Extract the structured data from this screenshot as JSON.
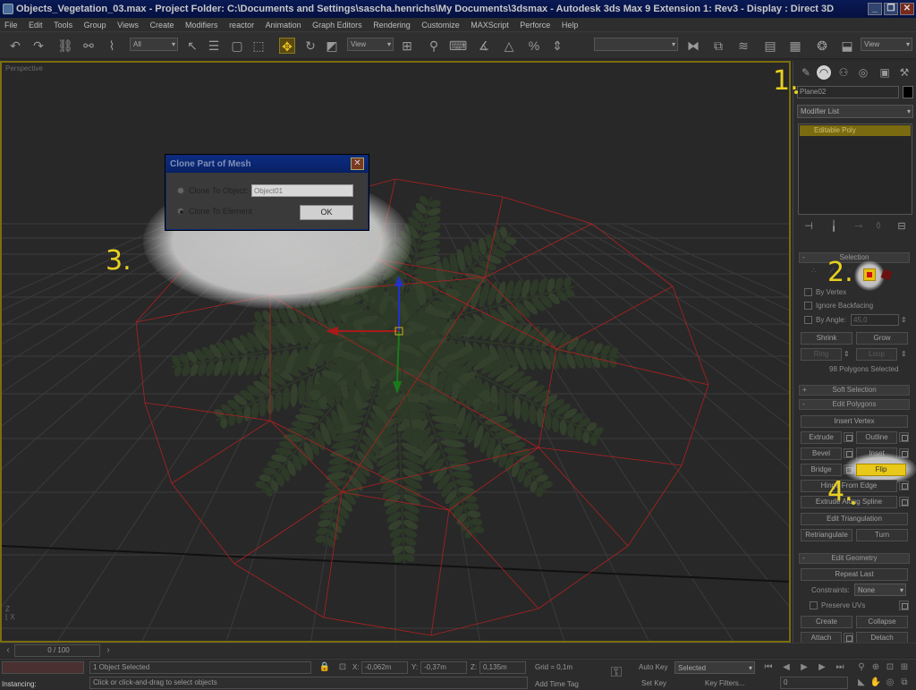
{
  "window": {
    "title": "Objects_Vegetation_03.max    - Project Folder: C:\\Documents and Settings\\sascha.henrichs\\My Documents\\3dsmax    - Autodesk 3ds Max 9 Extension 1: Rev3    - Display : Direct 3D"
  },
  "menu": [
    "File",
    "Edit",
    "Tools",
    "Group",
    "Views",
    "Create",
    "Modifiers",
    "reactor",
    "Animation",
    "Graph Editors",
    "Rendering",
    "Customize",
    "MAXScript",
    "Perforce",
    "Help"
  ],
  "toolbar": {
    "selection_filter": "All",
    "reference_coord": "View",
    "named_selection": "",
    "view_dropdown": "View"
  },
  "viewport": {
    "label": "Perspective"
  },
  "dialog": {
    "title": "Clone Part of Mesh",
    "option_object": "Clone To Object:",
    "object_name_placeholder": "Object01",
    "option_element": "Clone To Element",
    "ok_label": "OK"
  },
  "callouts": {
    "one": "1.",
    "two": "2.",
    "three": "3.",
    "four": "4."
  },
  "command_panel": {
    "object_name": "Plane02",
    "modifier_list": "Modifier List",
    "stack_item": "Editable Poly",
    "selection": {
      "header": "Selection",
      "by_vertex": "By Vertex",
      "ignore_backfacing": "Ignore Backfacing",
      "by_angle": "By Angle:",
      "angle_value": "45,0",
      "shrink": "Shrink",
      "grow": "Grow",
      "ring": "Ring",
      "loop": "Loop",
      "status": "98 Polygons Selected"
    },
    "soft_selection": "Soft Selection",
    "edit_polygons": {
      "header": "Edit Polygons",
      "insert_vertex": "Insert Vertex",
      "extrude": "Extrude",
      "outline": "Outline",
      "bevel": "Bevel",
      "inset": "Inset",
      "bridge": "Bridge",
      "flip": "Flip",
      "hinge": "Hinge From Edge",
      "extrude_spline": "Extrude Along Spline",
      "edit_triangulation": "Edit Triangulation",
      "retriangulate": "Retriangulate",
      "turn": "Turn"
    },
    "edit_geometry": {
      "header": "Edit Geometry",
      "repeat_last": "Repeat Last",
      "constraints": "Constraints:",
      "constraints_value": "None",
      "preserve_uvs": "Preserve UVs",
      "create": "Create",
      "collapse": "Collapse",
      "attach": "Attach",
      "detach": "Detach"
    }
  },
  "trackbar": {
    "frame": "0 / 100"
  },
  "status": {
    "selected": "1 Object Selected",
    "prompt": "Click or click-and-drag to select objects",
    "instancing": "Instancing:",
    "x_label": "X:",
    "x": "-0,062m",
    "y_label": "Y:",
    "y": "-0,37m",
    "z_label": "Z:",
    "z": "0,135m",
    "grid": "Grid = 0,1m",
    "add_time_tag": "Add Time Tag",
    "auto_key": "Auto Key",
    "set_key": "Set Key",
    "key_mode": "Selected",
    "key_filters": "Key Filters...",
    "current_frame": "0"
  },
  "colors": {
    "accent": "#e8d020",
    "viewport_border": "#7a6e10",
    "wire": "#b02020",
    "foliage": "#3a4a30"
  }
}
